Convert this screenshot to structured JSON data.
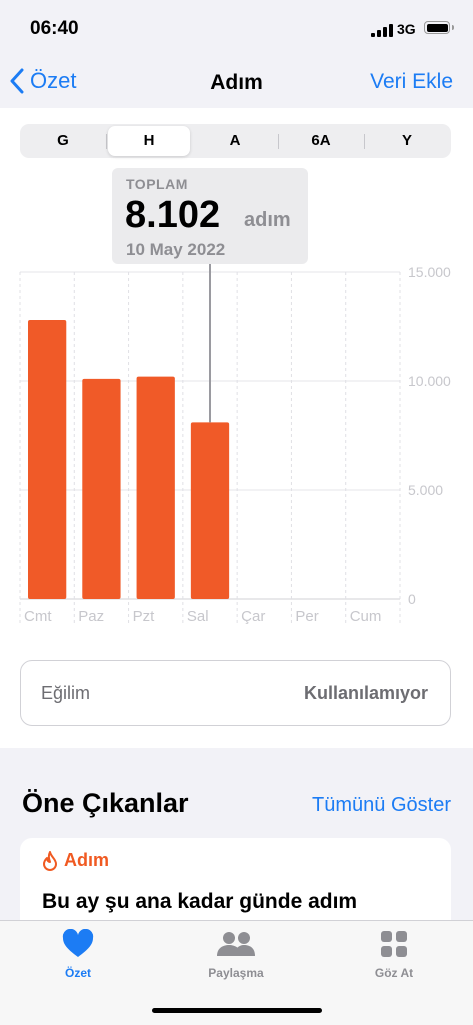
{
  "status": {
    "time": "06:40",
    "network": "3G"
  },
  "nav": {
    "back_label": "Özet",
    "title": "Adım",
    "action_label": "Veri Ekle"
  },
  "segments": [
    "G",
    "H",
    "A",
    "6A",
    "Y"
  ],
  "selected_segment": "H",
  "tooltip": {
    "label": "TOPLAM",
    "value": "8.102",
    "unit": "adım",
    "date": "10 May 2022"
  },
  "chart_data": {
    "type": "bar",
    "categories": [
      "Cmt",
      "Paz",
      "Pzt",
      "Sal",
      "Çar",
      "Per",
      "Cum"
    ],
    "values": [
      12800,
      10100,
      10200,
      8102,
      null,
      null,
      null
    ],
    "y_ticks": [
      "15.000",
      "10.000",
      "5.000",
      "0"
    ],
    "y_tick_values": [
      15000,
      10000,
      5000,
      0
    ],
    "ylim": [
      0,
      15000
    ],
    "highlighted_category": "Sal",
    "bar_color": "#f05a28"
  },
  "trend": {
    "label": "Eğilim",
    "value": "Kullanılamıyor"
  },
  "highlights": {
    "title": "Öne Çıkanlar",
    "show_all": "Tümünü Göster",
    "card": {
      "category": "Adım",
      "text": "Bu ay şu ana kadar günde adım"
    }
  },
  "tabs": [
    {
      "label": "Özet",
      "icon": "heart-icon",
      "active": true
    },
    {
      "label": "Paylaşma",
      "icon": "people-icon",
      "active": false
    },
    {
      "label": "Göz At",
      "icon": "grid-icon",
      "active": false
    }
  ],
  "colors": {
    "accent": "#1c7cf4",
    "bar": "#f05a28",
    "inactive": "#8e8e93"
  }
}
